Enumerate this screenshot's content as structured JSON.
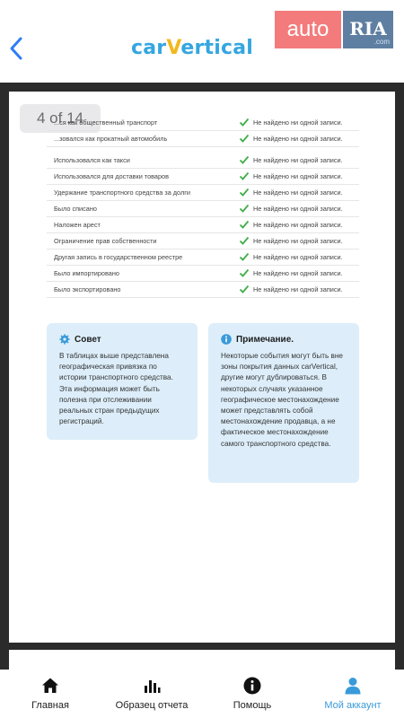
{
  "header": {
    "logo_pre": "car",
    "logo_v": "V",
    "logo_post": "ertical",
    "autoria_left": "auto",
    "autoria_right": "RIA",
    "autoria_com": ".com"
  },
  "pager": "4 of 14",
  "rows_group1": [
    {
      "label": "...ся как общественный транспорт",
      "result": "Не найдено ни одной записи."
    },
    {
      "label": "...зовался как прокатный автомобиль",
      "result": "Не найдено ни одной записи."
    }
  ],
  "rows_group2": [
    {
      "label": "Использовался как такси",
      "result": "Не найдено ни одной записи."
    },
    {
      "label": "Использовался для доставки товаров",
      "result": "Не найдено ни одной записи."
    },
    {
      "label": "Удержание транспортного средства за долги",
      "result": "Не найдено ни одной записи."
    },
    {
      "label": "Было списано",
      "result": "Не найдено ни одной записи."
    },
    {
      "label": "Наложен арест",
      "result": "Не найдено ни одной записи."
    },
    {
      "label": "Ограничение прав собственности",
      "result": "Не найдено ни одной записи."
    },
    {
      "label": "Другая запись в государственном реестре",
      "result": "Не найдено ни одной записи."
    },
    {
      "label": "Было импортировано",
      "result": "Не найдено ни одной записи."
    },
    {
      "label": "Было экспортировано",
      "result": "Не найдено ни одной записи."
    }
  ],
  "tip": {
    "title": "Совет",
    "body": "В таблицах выше представлена географическая привязка по истории транспортного средства. Эта информация может быть полезна при отслеживании реальных стран предыдущих регистраций."
  },
  "note": {
    "title": "Примечание.",
    "body": "Некоторые события могут быть вне зоны покрытия данных carVertical, другие могут дублироваться. В некоторых случаях указанное географическое местонахождение может представлять собой местонахождение продавца, а не фактическое местонахождение самого транспортного средства."
  },
  "tabs": [
    {
      "label": "Главная",
      "icon": "home-icon"
    },
    {
      "label": "Образец отчета",
      "icon": "bar-chart-icon"
    },
    {
      "label": "Помощь",
      "icon": "info-icon"
    },
    {
      "label": "Мой аккаунт",
      "icon": "user-icon"
    }
  ],
  "colors": {
    "accent": "#3a9ad9",
    "check": "#3fae49",
    "card_bg": "#ddeefa",
    "logo_blue": "#35a6e0",
    "logo_yellow": "#f2b81f"
  }
}
